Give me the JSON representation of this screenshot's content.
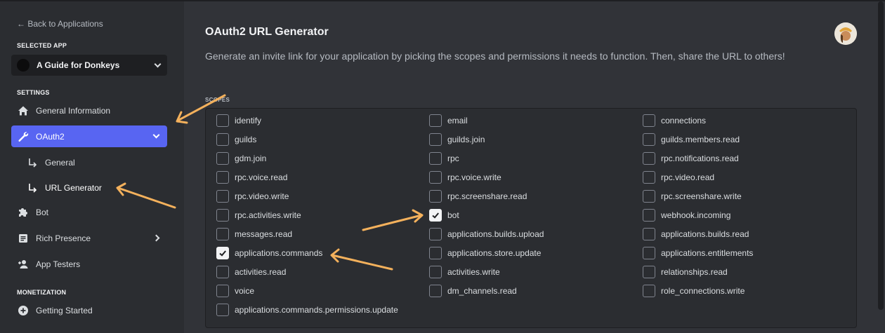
{
  "sidebar": {
    "back_label": "← Back to Applications",
    "selected_app_label": "SELECTED APP",
    "app_name": "A Guide for Donkeys",
    "settings_label": "SETTINGS",
    "monetization_label": "MONETIZATION",
    "items": [
      {
        "label": "General Information",
        "icon": "home-icon"
      },
      {
        "label": "OAuth2",
        "icon": "wrench-icon",
        "active": true
      },
      {
        "label": "General",
        "icon": "sub-arrow-icon"
      },
      {
        "label": "URL Generator",
        "icon": "sub-arrow-icon",
        "active": true
      },
      {
        "label": "Bot",
        "icon": "puzzle-icon"
      },
      {
        "label": "Rich Presence",
        "icon": "document-icon"
      },
      {
        "label": "App Testers",
        "icon": "user-plus-icon"
      },
      {
        "label": "Getting Started",
        "icon": "plus-circle-icon"
      }
    ]
  },
  "main": {
    "title": "OAuth2 URL Generator",
    "description": "Generate an invite link for your application by picking the scopes and permissions it needs to function. Then, share the URL to others!",
    "scopes_label": "SCOPES",
    "scopes": [
      {
        "label": "identify",
        "checked": false
      },
      {
        "label": "email",
        "checked": false
      },
      {
        "label": "connections",
        "checked": false
      },
      {
        "label": "guilds",
        "checked": false
      },
      {
        "label": "guilds.join",
        "checked": false
      },
      {
        "label": "guilds.members.read",
        "checked": false
      },
      {
        "label": "gdm.join",
        "checked": false
      },
      {
        "label": "rpc",
        "checked": false
      },
      {
        "label": "rpc.notifications.read",
        "checked": false
      },
      {
        "label": "rpc.voice.read",
        "checked": false
      },
      {
        "label": "rpc.voice.write",
        "checked": false
      },
      {
        "label": "rpc.video.read",
        "checked": false
      },
      {
        "label": "rpc.video.write",
        "checked": false
      },
      {
        "label": "rpc.screenshare.read",
        "checked": false
      },
      {
        "label": "rpc.screenshare.write",
        "checked": false
      },
      {
        "label": "rpc.activities.write",
        "checked": false
      },
      {
        "label": "bot",
        "checked": true
      },
      {
        "label": "webhook.incoming",
        "checked": false
      },
      {
        "label": "messages.read",
        "checked": false
      },
      {
        "label": "applications.builds.upload",
        "checked": false
      },
      {
        "label": "applications.builds.read",
        "checked": false
      },
      {
        "label": "applications.commands",
        "checked": true
      },
      {
        "label": "applications.store.update",
        "checked": false
      },
      {
        "label": "applications.entitlements",
        "checked": false
      },
      {
        "label": "activities.read",
        "checked": false
      },
      {
        "label": "activities.write",
        "checked": false
      },
      {
        "label": "relationships.read",
        "checked": false
      },
      {
        "label": "voice",
        "checked": false
      },
      {
        "label": "dm_channels.read",
        "checked": false
      },
      {
        "label": "role_connections.write",
        "checked": false
      },
      {
        "label": "applications.commands.permissions.update",
        "checked": false
      }
    ]
  },
  "colors": {
    "accent": "#5865f2",
    "annotation_arrow": "#f4b15c",
    "background": "#313338",
    "sidebar": "#2b2d31"
  }
}
